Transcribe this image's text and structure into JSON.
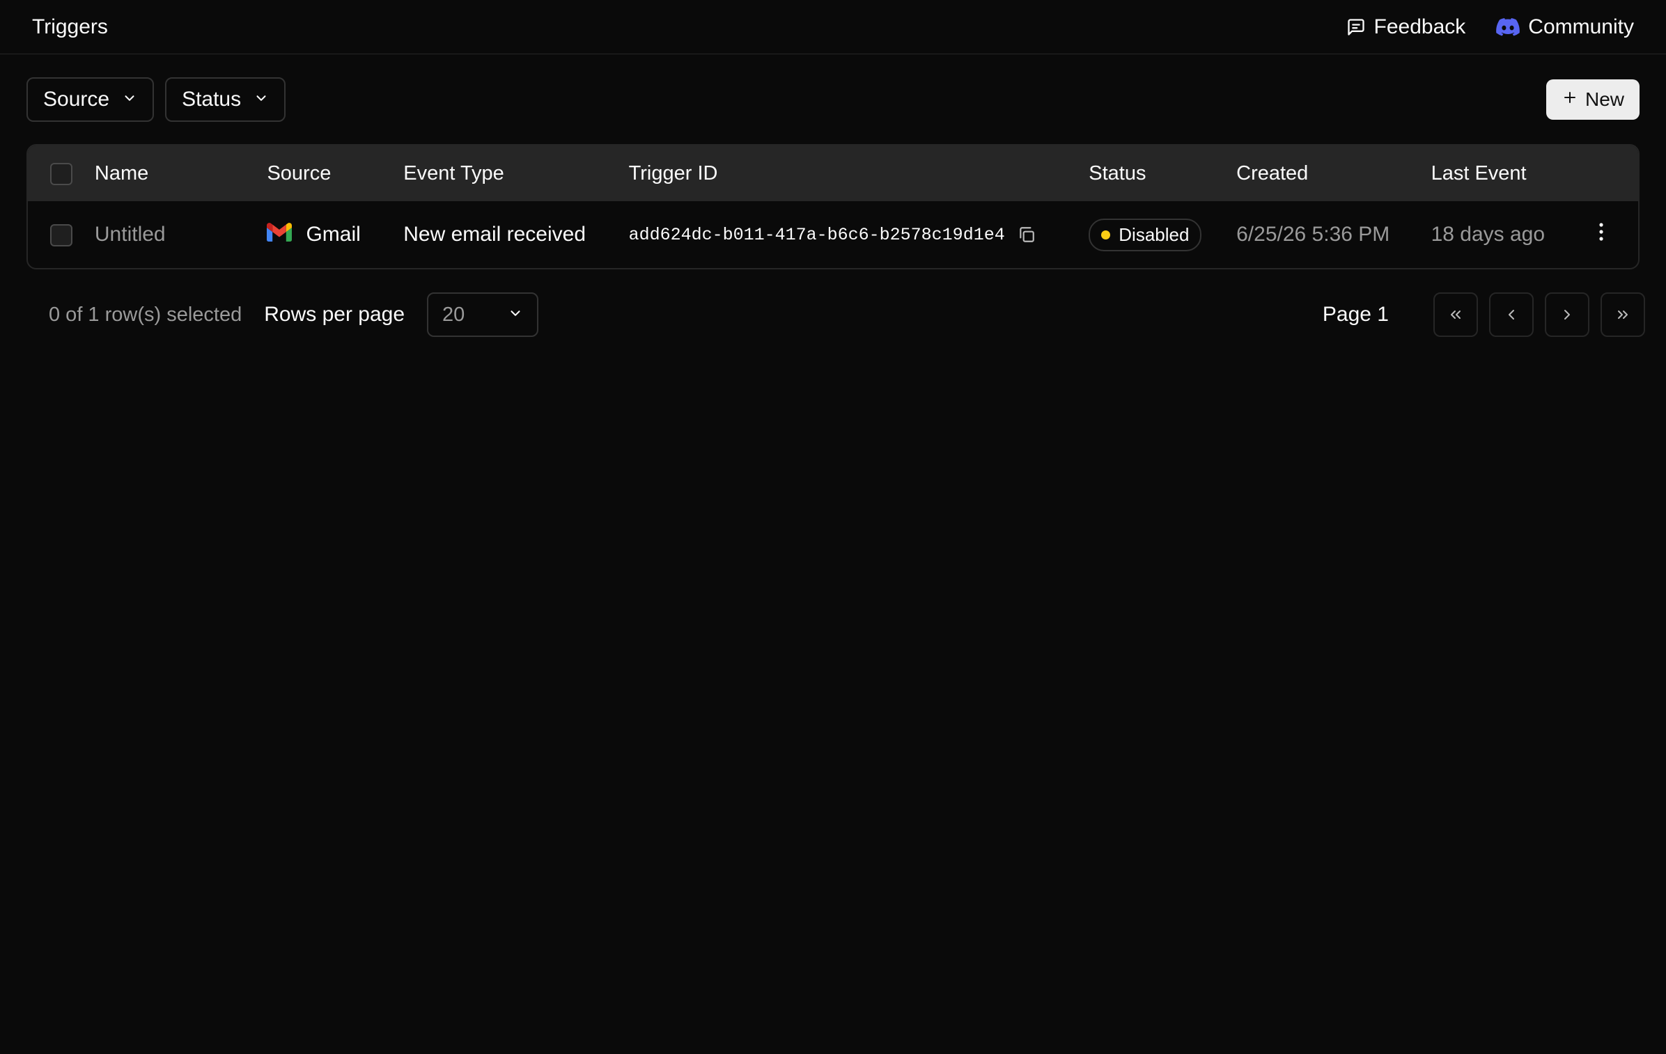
{
  "header": {
    "title": "Triggers",
    "feedback_label": "Feedback",
    "community_label": "Community"
  },
  "filters": {
    "source_label": "Source",
    "status_label": "Status"
  },
  "toolbar": {
    "new_label": "New"
  },
  "table": {
    "columns": [
      "Name",
      "Source",
      "Event Type",
      "Trigger ID",
      "Status",
      "Created",
      "Last Event"
    ],
    "rows": [
      {
        "name": "Untitled",
        "source": "Gmail",
        "event_type": "New email received",
        "trigger_id": "add624dc-b011-417a-b6c6-b2578c19d1e4",
        "status": "Disabled",
        "created": "6/25/26 5:36 PM",
        "last_event": "18 days ago"
      }
    ]
  },
  "footer": {
    "selection_text": "0 of 1 row(s) selected",
    "rows_per_page_label": "Rows per page",
    "rows_per_page_value": "20",
    "page_label": "Page 1"
  },
  "colors": {
    "background": "#0a0a0a",
    "header_row": "#262626",
    "status_disabled_dot": "#facc15",
    "discord": "#5865f2"
  }
}
